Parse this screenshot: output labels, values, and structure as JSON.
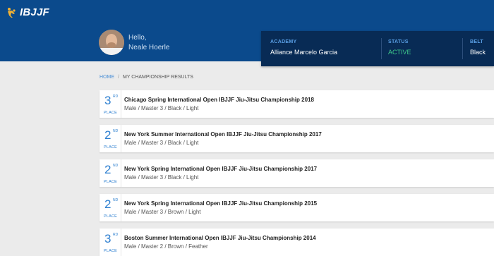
{
  "brand": {
    "logo_text": "IBJJF",
    "logo_icon": "ibjjf-grappler-icon"
  },
  "user": {
    "greeting": "Hello,",
    "name": "Neale Hoerle"
  },
  "profile": {
    "academy_label": "ACADEMY",
    "academy": "Alliance Marcelo Garcia",
    "status_label": "STATUS",
    "status": "ACTIVE",
    "belt_label": "BELT",
    "belt": "Black"
  },
  "breadcrumb": {
    "home": "HOME",
    "separator": "/",
    "current": "MY CHAMPIONSHIP RESULTS"
  },
  "results": [
    {
      "place": "3",
      "suffix": "RD",
      "place_word": "PLACE",
      "title": "Chicago Spring International Open IBJJF Jiu-Jitsu Championship 2018",
      "division": "Male / Master 3 / Black / Light"
    },
    {
      "place": "2",
      "suffix": "ND",
      "place_word": "PLACE",
      "title": "New York Summer International Open IBJJF Jiu-Jitsu Championship 2017",
      "division": "Male / Master 3 / Black / Light"
    },
    {
      "place": "2",
      "suffix": "ND",
      "place_word": "PLACE",
      "title": "New York Spring International Open IBJJF Jiu-Jitsu Championship 2017",
      "division": "Male / Master 3 / Black / Light"
    },
    {
      "place": "2",
      "suffix": "ND",
      "place_word": "PLACE",
      "title": "New York Spring International Open IBJJF Jiu-Jitsu Championship 2015",
      "division": "Male / Master 3 / Brown / Light"
    },
    {
      "place": "3",
      "suffix": "RD",
      "place_word": "PLACE",
      "title": "Boston Summer International Open IBJJF Jiu-Jitsu Championship 2014",
      "division": "Male / Master 2 / Brown / Feather"
    }
  ],
  "colors": {
    "header": "#0b4a8c",
    "card": "#082b55",
    "accent": "#2d7fd0",
    "active": "#3ec98b"
  }
}
